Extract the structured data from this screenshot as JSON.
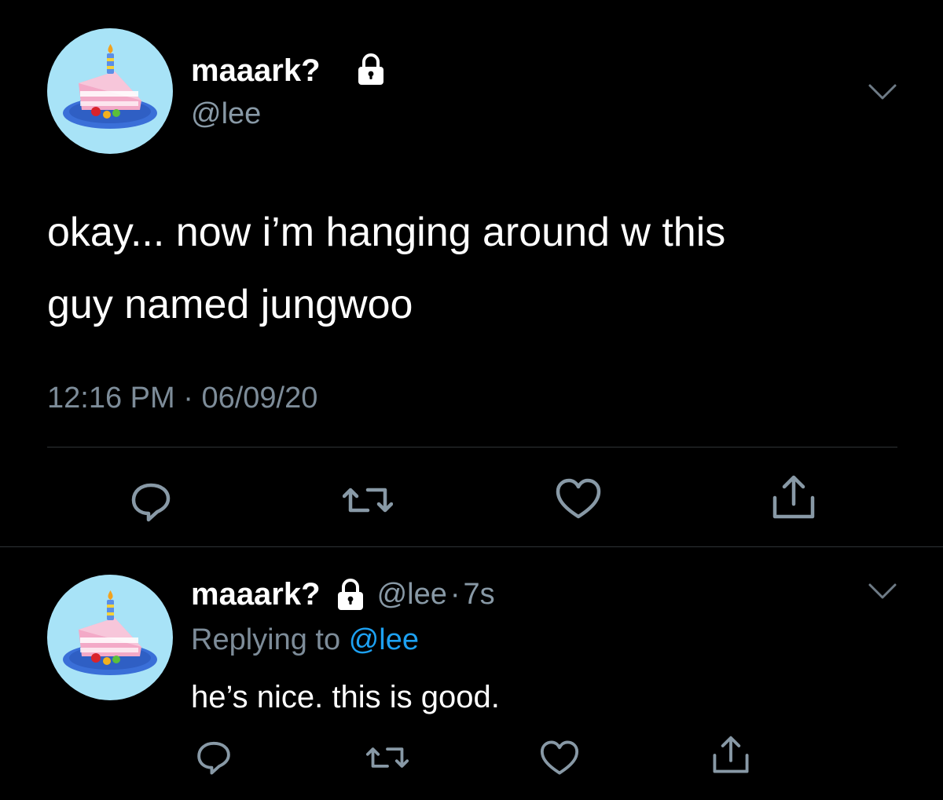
{
  "main_tweet": {
    "display_name": "maaark?",
    "handle": "@lee",
    "text_lines": [
      "okay... now i’m hanging around w this",
      "guy named jungwoo"
    ],
    "time": "12:16 PM",
    "separator": " · ",
    "date": "06/09/20",
    "avatar_icon": "birthday-cake-avatar",
    "lock_icon": "lock-icon",
    "menu_icon": "chevron-down-icon"
  },
  "reply_tweet": {
    "display_name": "maaark?",
    "handle": "@lee",
    "age": "7s",
    "separator": "·",
    "replying_label": "Replying to",
    "replying_mention": "@lee",
    "text": "he’s nice. this is good.",
    "avatar_icon": "birthday-cake-avatar",
    "lock_icon": "lock-icon",
    "menu_icon": "chevron-down-icon"
  },
  "actions": {
    "reply": "reply-icon",
    "retweet": "retweet-icon",
    "like": "like-icon",
    "share": "share-icon"
  },
  "colors": {
    "background": "#000000",
    "primary_text": "#ffffff",
    "secondary_text": "#8899a6",
    "mention": "#1da1f2",
    "divider": "#2f3336",
    "avatar_bg": "#a8e3f7"
  }
}
